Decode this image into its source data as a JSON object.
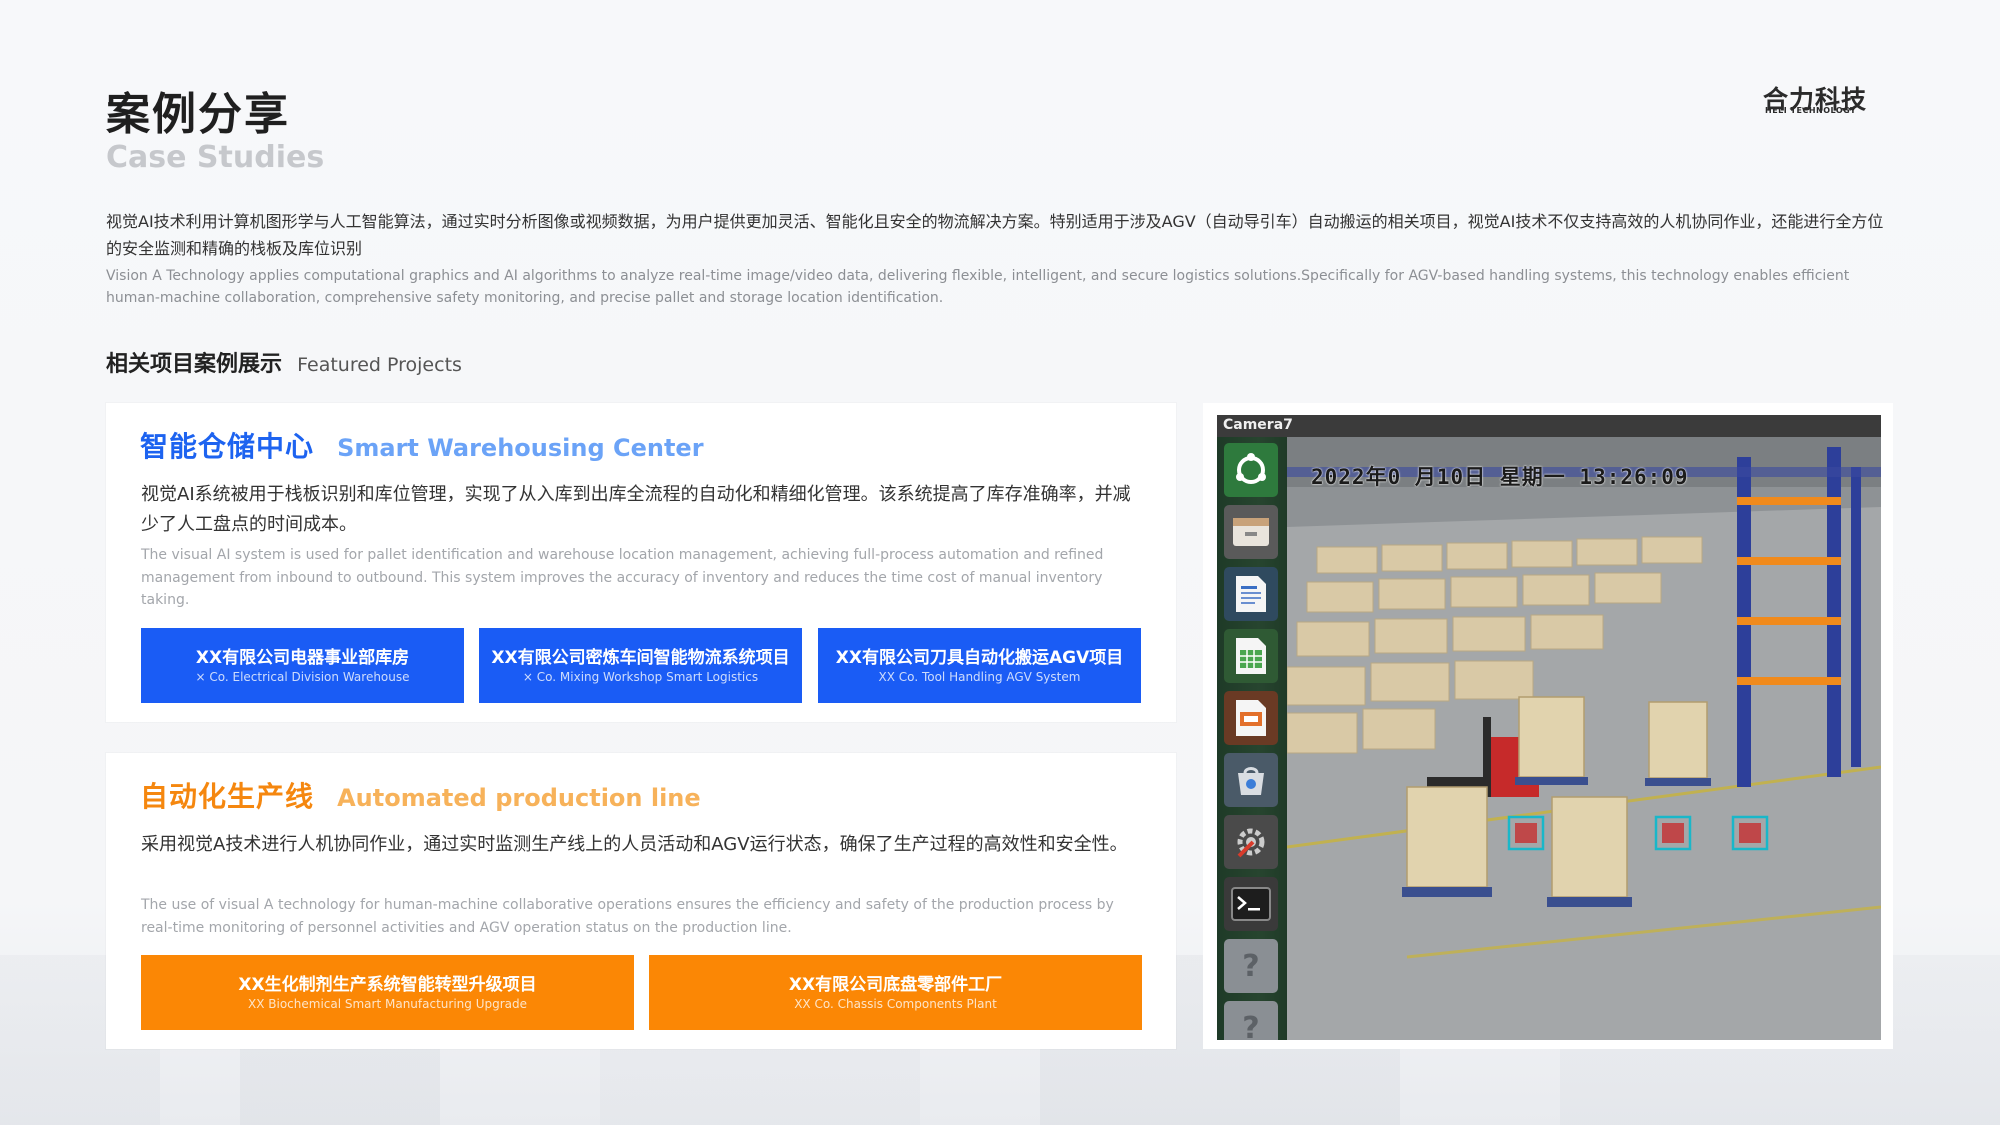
{
  "header": {
    "title_zh": "案例分享",
    "title_en": "Case Studies",
    "logo_main": "合力科技",
    "logo_sub": "HELI TECHNOLOGY"
  },
  "intro": {
    "zh": "视觉AI技术利用计算机图形学与人工智能算法，通过实时分析图像或视频数据，为用户提供更加灵活、智能化且安全的物流解决方案。特别适用于涉及AGV（自动导引车）自动搬运的相关项目，视觉AI技术不仅支持高效的人机协同作业，还能进行全方位的安全监测和精确的栈板及库位识别",
    "en": "Vision A Technology applies computational graphics and AI algorithms to analyze real-time image/video data, delivering flexible, intelligent, and secure logistics solutions.Specifically for AGV-based handling systems, this technology enables efficient human-machine collaboration, comprehensive safety monitoring, and precise pallet and storage location identification."
  },
  "section": {
    "title_zh": "相关项目案例展示",
    "title_en": "Featured Projects"
  },
  "cards": [
    {
      "title_zh": "智能仓储中心",
      "title_en": "Smart Warehousing Center",
      "desc_zh": "视觉AI系统被用于栈板识别和库位管理，实现了从入库到出库全流程的自动化和精细化管理。该系统提高了库存准确率，并减少了人工盘点的时间成本。",
      "desc_en": "The visual AI system is used for pallet identification and warehouse location management, achieving full-process automation and refined management from inbound to outbound. This system improves the accuracy of inventory and reduces the time cost of manual inventory taking.",
      "projects": [
        {
          "zh": "XX有限公司电器事业部库房",
          "en": "× Co. Electrical Division Warehouse"
        },
        {
          "zh": "XX有限公司密炼车间智能物流系统项目",
          "en": "× Co. Mixing Workshop Smart Logistics"
        },
        {
          "zh": "XX有限公司刀具自动化搬运AGV项目",
          "en": "XX Co. Tool Handling AGV System"
        }
      ],
      "accent": "#1a5cf5"
    },
    {
      "title_zh": "自动化生产线",
      "title_en": "Automated production line",
      "desc_zh": "采用视觉A技术进行人机协同作业，通过实时监测生产线上的人员活动和AGV运行状态，确保了生产过程的高效性和安全性。",
      "desc_en": "The use of visual A technology for human-machine collaborative operations ensures the efficiency and safety of the production process by real-time monitoring of personnel activities and AGV operation status on the production line.",
      "projects": [
        {
          "zh": "XX生化制剂生产系统智能转型升级项目",
          "en": "XX Biochemical Smart Manufacturing Upgrade"
        },
        {
          "zh": "XX有限公司底盘零部件工厂",
          "en": "XX Co. Chassis Components Plant"
        }
      ],
      "accent": "#fb8705"
    }
  ],
  "camera": {
    "label": "Camera7",
    "osd": "2022年0 月10日 星期一 13:26:09",
    "launcher_icons": [
      "ubuntu-icon",
      "files-icon",
      "document-icon",
      "spreadsheet-icon",
      "presentation-icon",
      "store-icon",
      "settings-icon",
      "terminal-icon",
      "help-icon",
      "help-icon"
    ]
  }
}
